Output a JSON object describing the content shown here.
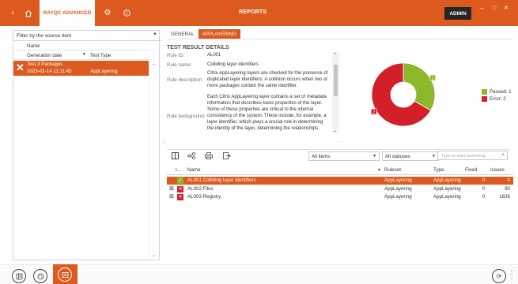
{
  "topbar": {
    "back_icon": "chevron-left-icon",
    "home_icon": "home-icon",
    "app_tab": "RAYQC ADVANCED",
    "settings_icon": "gear-icon",
    "info_icon": "info-icon",
    "title": "REPORTS",
    "admin": "ADMIN",
    "minimize": "–",
    "maximize": "□",
    "close": "✕",
    "accent": "#dd5a1f"
  },
  "left": {
    "filter": "Filter by the source item",
    "col_name": "Name",
    "col_date": "Generation date",
    "col_type": "Test Type",
    "row": {
      "name": "Test 3 Packages",
      "date": "2023-02-14 11:11:45",
      "type": "AppLayering",
      "icon": "error-x-icon"
    }
  },
  "right": {
    "tabs": [
      "GENERAL",
      "APPLAYERING"
    ],
    "active_tab": 1,
    "details_title": "TEST RESULT DETAILS",
    "rule_id_label": "Rule ID:",
    "rule_id": "AL001",
    "rule_name_label": "Rule name:",
    "rule_name": "Colliding layer identifiers",
    "rule_desc_label": "Rule description:",
    "rule_desc": "Citrix AppLayering layers are checked for the presence of duplicated layer identifiers. A collision occurs when two or more packages contain the same identifier.",
    "rule_bg_label": "Rule background:",
    "rule_bg": "Each Citrix AppLayering layer contains a set of metadata information that describes basic properties of the layer. Some of these properties are critical to the internal consistency of the system. These include, for example, a layer identifier, which plays a crucial role in determining the identity of the layer, determining the relationships,"
  },
  "chart_data": {
    "type": "pie",
    "categories": [
      "Passed",
      "Error"
    ],
    "values": [
      1,
      2
    ],
    "data_labels": [
      "1",
      "2"
    ],
    "colors": [
      "#8db82c",
      "#d21f2a"
    ],
    "legend": [
      "Passed: 1",
      "Error: 2"
    ],
    "legend_position": "right"
  },
  "toolbar": {
    "icons": [
      "columns-icon",
      "tree-icon",
      "print-icon",
      "export-icon"
    ],
    "items_filter": "All items",
    "status_filter": "All statuses",
    "search_placeholder": "Type to start searching...",
    "search_icon": "search-icon"
  },
  "grid": {
    "headers": {
      "expand": "I...",
      "name": "Name",
      "ruleset": "Ruleset",
      "type": "Type",
      "fixed": "Fixed",
      "issues": "Issues"
    },
    "rows": [
      {
        "expand": "",
        "status": "passed",
        "name": "AL001 Colliding layer identifiers",
        "ruleset": "AppLayering",
        "type": "AppLayering",
        "fixed": "0",
        "issues": "0"
      },
      {
        "expand": "⊞",
        "status": "error",
        "name": "AL002 Files",
        "ruleset": "AppLayering",
        "type": "AppLayering",
        "fixed": "0",
        "issues": "90"
      },
      {
        "expand": "⊞",
        "status": "error",
        "name": "AL003 Registry",
        "ruleset": "AppLayering",
        "type": "AppLayering",
        "fixed": "0",
        "issues": "1626"
      }
    ]
  },
  "bottom": {
    "icons": [
      "packages-icon",
      "palette-icon",
      "reports-icon",
      "refresh-icon",
      "more-icon"
    ]
  }
}
